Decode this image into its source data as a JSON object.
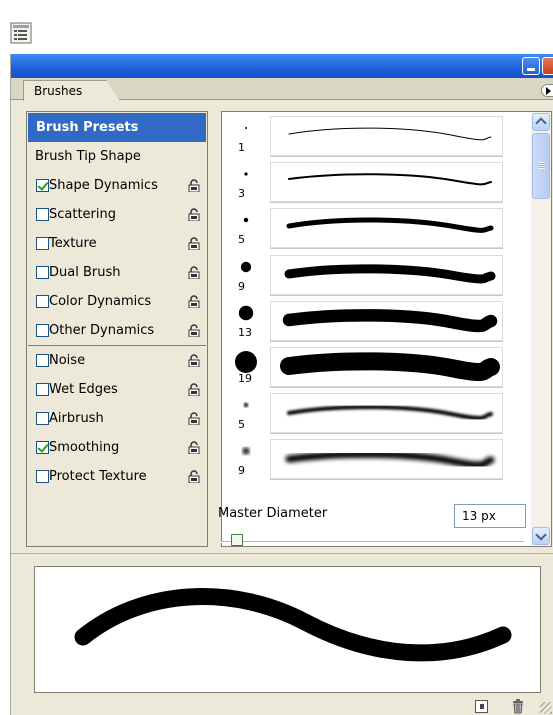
{
  "panel": {
    "tab_label": "Brushes"
  },
  "options": {
    "presets_label": "Brush Presets",
    "tip_shape_label": "Brush Tip Shape",
    "items": [
      {
        "label": "Shape Dynamics",
        "checked": true
      },
      {
        "label": "Scattering",
        "checked": false
      },
      {
        "label": "Texture",
        "checked": false
      },
      {
        "label": "Dual Brush",
        "checked": false
      },
      {
        "label": "Color Dynamics",
        "checked": false
      },
      {
        "label": "Other Dynamics",
        "checked": false
      },
      {
        "label": "Noise",
        "checked": false
      },
      {
        "label": "Wet Edges",
        "checked": false
      },
      {
        "label": "Airbrush",
        "checked": false
      },
      {
        "label": "Smoothing",
        "checked": true
      },
      {
        "label": "Protect Texture",
        "checked": false
      }
    ]
  },
  "brushes": [
    {
      "size": "1",
      "hardness": "hard"
    },
    {
      "size": "3",
      "hardness": "hard"
    },
    {
      "size": "5",
      "hardness": "hard"
    },
    {
      "size": "9",
      "hardness": "hard"
    },
    {
      "size": "13",
      "hardness": "hard"
    },
    {
      "size": "19",
      "hardness": "hard"
    },
    {
      "size": "5",
      "hardness": "soft"
    },
    {
      "size": "9",
      "hardness": "soft"
    }
  ],
  "master_diameter": {
    "label": "Master Diameter",
    "value": "13 px"
  }
}
